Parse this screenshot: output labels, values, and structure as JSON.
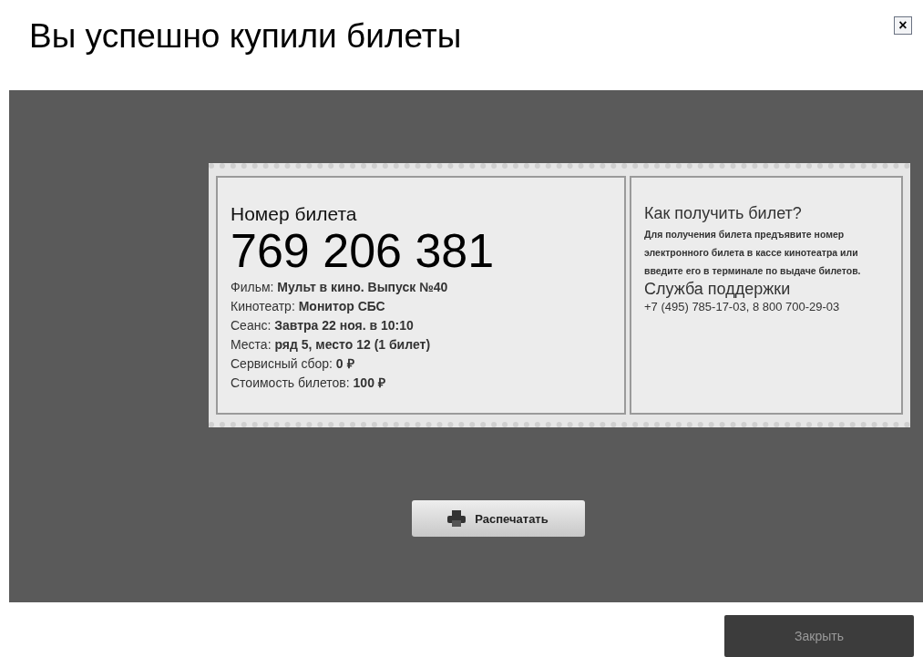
{
  "dialog": {
    "title": "Вы успешно купили билеты",
    "close_icon": "×"
  },
  "ticket": {
    "number_label": "Номер билета",
    "number": "769 206 381",
    "details": [
      "Фильм: **Мульт в кино. Выпуск №40**",
      "Кинотеатр: **Монитор СБС**",
      "Сеанс: **Завтра 22 ноя. в 10:10**",
      "Места: **ряд 5, место 12 (1 билет)**",
      "Сервисный сбор: **0 ₽**",
      "Стоимость билетов: **100 ₽**"
    ],
    "help_title": "Как получить билет?",
    "help_text": "Для получения билета предъявите номер электронного билета в кассе кинотеатра или введите его в терминале по выдаче билетов.",
    "support_title": "Служба поддержки",
    "support_phones": "+7 (495) 785-17-03, 8 800 700-29-03"
  },
  "print_button": "Распечатать",
  "close_button": "Закрыть"
}
